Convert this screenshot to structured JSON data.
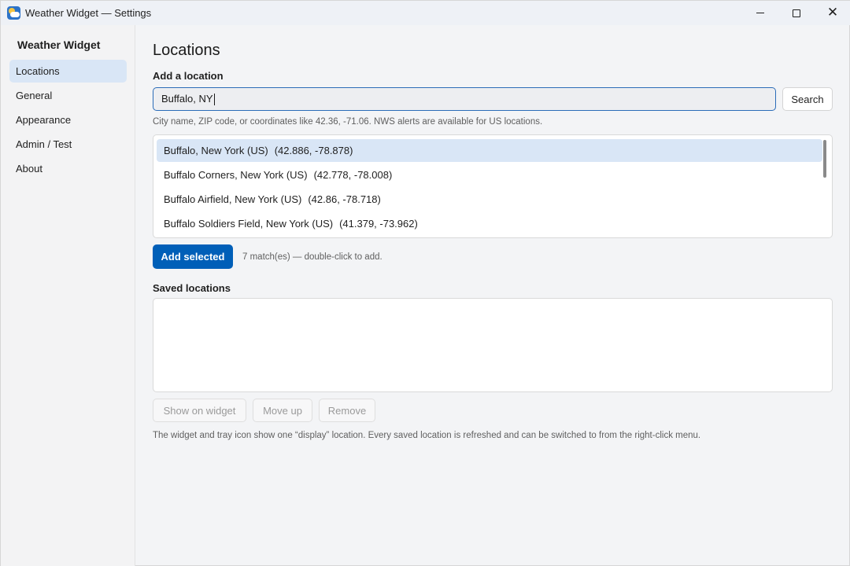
{
  "window": {
    "title": "Weather Widget — Settings",
    "icon": "weather-app-icon"
  },
  "sidebar": {
    "title": "Weather Widget",
    "items": [
      {
        "label": "Locations",
        "active": true
      },
      {
        "label": "General",
        "active": false
      },
      {
        "label": "Appearance",
        "active": false
      },
      {
        "label": "Admin / Test",
        "active": false
      },
      {
        "label": "About",
        "active": false
      }
    ]
  },
  "main": {
    "title": "Locations",
    "add_section": {
      "label": "Add a location",
      "input_value": "Buffalo, NY",
      "search_button": "Search",
      "hint": "City name, ZIP code, or coordinates like 42.36, -71.06. NWS alerts are available for US locations."
    },
    "results": [
      {
        "name": "Buffalo, New York (US)",
        "coords": "(42.886, -78.878)",
        "selected": true
      },
      {
        "name": "Buffalo Corners, New York (US)",
        "coords": "(42.778, -78.008)",
        "selected": false
      },
      {
        "name": "Buffalo Airfield, New York (US)",
        "coords": "(42.86, -78.718)",
        "selected": false
      },
      {
        "name": "Buffalo Soldiers Field, New York (US)",
        "coords": "(41.379, -73.962)",
        "selected": false
      }
    ],
    "add_selected_button": "Add selected",
    "match_count": "7 match(es) — double-click to add.",
    "saved_section": {
      "label": "Saved locations",
      "items": []
    },
    "buttons": {
      "show_on_widget": "Show on widget",
      "move_up": "Move up",
      "remove": "Remove"
    },
    "footer_note": "The widget and tray icon show one “display” location. Every saved location is refreshed and can be switched to from the right-click menu."
  },
  "colors": {
    "accent": "#005fb8",
    "selection": "#d9e6f6",
    "input_border": "#2b6cb8"
  }
}
